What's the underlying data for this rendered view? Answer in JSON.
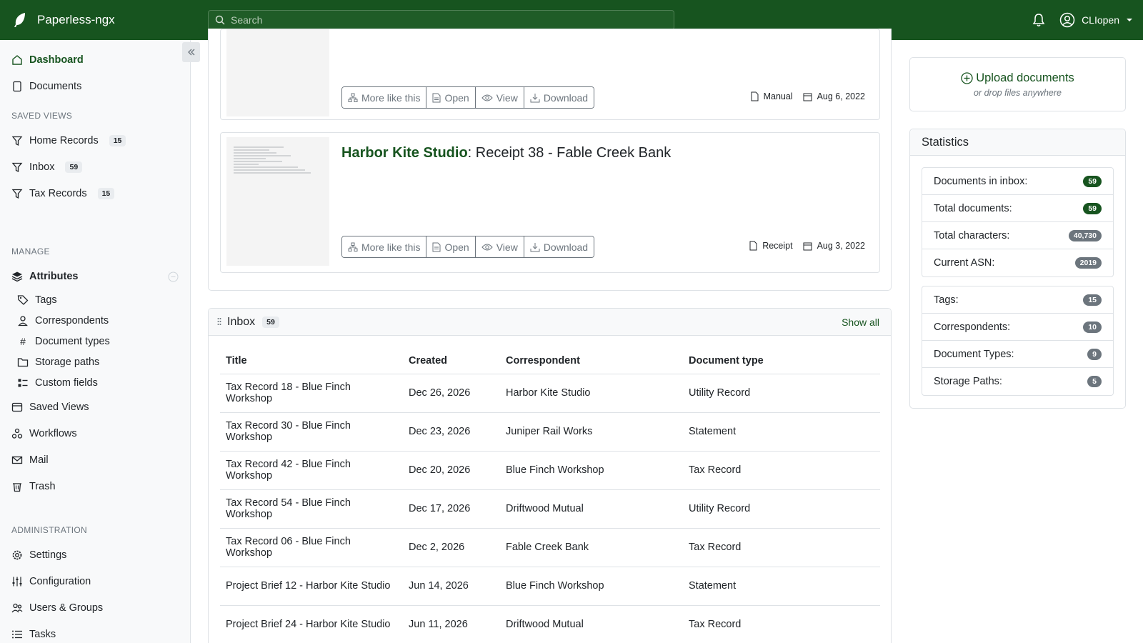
{
  "app": {
    "title": "Paperless-ngx"
  },
  "search": {
    "placeholder": "Search"
  },
  "user": {
    "name": "CLIopen"
  },
  "sidebar": {
    "dashboard": "Dashboard",
    "documents": "Documents",
    "saved_views_header": "SAVED VIEWS",
    "saved_views": [
      {
        "label": "Home Records",
        "count": "15"
      },
      {
        "label": "Inbox",
        "count": "59"
      },
      {
        "label": "Tax Records",
        "count": "15"
      }
    ],
    "manage_header": "MANAGE",
    "attributes": "Attributes",
    "attribute_items": [
      "Tags",
      "Correspondents",
      "Document types",
      "Storage paths",
      "Custom fields"
    ],
    "saved_views_link": "Saved Views",
    "workflows": "Workflows",
    "mail": "Mail",
    "trash": "Trash",
    "admin_header": "ADMINISTRATION",
    "settings": "Settings",
    "configuration": "Configuration",
    "users_groups": "Users & Groups",
    "tasks": "Tasks"
  },
  "doc_buttons": {
    "more_like_this": "More like this",
    "open": "Open",
    "view": "View",
    "download": "Download"
  },
  "doc_cards": [
    {
      "type": "Manual",
      "date": "Aug 6, 2022"
    },
    {
      "correspondent": "Harbor Kite Studio",
      "separator": ":",
      "title": " Receipt 38 - Fable Creek Bank",
      "type": "Receipt",
      "date": "Aug 3, 2022"
    }
  ],
  "inbox": {
    "title": "Inbox",
    "count": "59",
    "show_all": "Show all",
    "columns": [
      "Title",
      "Created",
      "Correspondent",
      "Document type"
    ],
    "rows": [
      [
        "Tax Record 18 - Blue Finch Workshop",
        "Dec 26, 2026",
        "Harbor Kite Studio",
        "Utility Record"
      ],
      [
        "Tax Record 30 - Blue Finch Workshop",
        "Dec 23, 2026",
        "Juniper Rail Works",
        "Statement"
      ],
      [
        "Tax Record 42 - Blue Finch Workshop",
        "Dec 20, 2026",
        "Blue Finch Workshop",
        "Tax Record"
      ],
      [
        "Tax Record 54 - Blue Finch Workshop",
        "Dec 17, 2026",
        "Driftwood Mutual",
        "Utility Record"
      ],
      [
        "Tax Record 06 - Blue Finch Workshop",
        "Dec 2, 2026",
        "Fable Creek Bank",
        "Tax Record"
      ],
      [
        "Project Brief 12 - Harbor Kite Studio",
        "Jun 14, 2026",
        "Blue Finch Workshop",
        "Statement"
      ],
      [
        "Project Brief 24 - Harbor Kite Studio",
        "Jun 11, 2026",
        "Driftwood Mutual",
        "Tax Record"
      ]
    ]
  },
  "upload": {
    "label": "Upload documents",
    "sub": "or drop files anywhere"
  },
  "statistics": {
    "title": "Statistics",
    "group1": [
      {
        "label": "Documents in inbox:",
        "value": "59"
      },
      {
        "label": "Total documents:",
        "value": "59"
      },
      {
        "label": "Total characters:",
        "value": "40,730"
      },
      {
        "label": "Current ASN:",
        "value": "2019"
      }
    ],
    "group2": [
      {
        "label": "Tags:",
        "value": "15"
      },
      {
        "label": "Correspondents:",
        "value": "10"
      },
      {
        "label": "Document Types:",
        "value": "9"
      },
      {
        "label": "Storage Paths:",
        "value": "5"
      }
    ]
  },
  "colors": {
    "brand": "#17541f",
    "badge_gray": "#6c757d"
  }
}
